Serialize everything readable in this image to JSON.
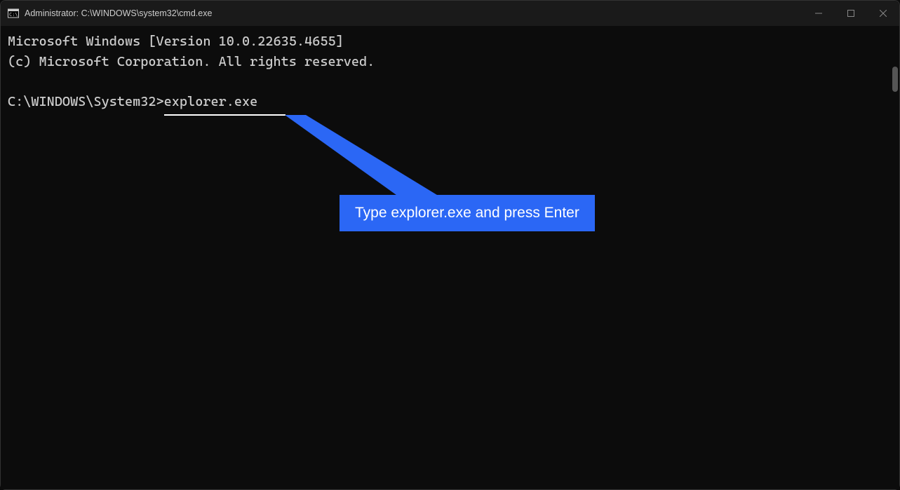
{
  "window": {
    "title": "Administrator: C:\\WINDOWS\\system32\\cmd.exe"
  },
  "terminal": {
    "line1": "Microsoft Windows [Version 10.0.22635.4655]",
    "line2": "(c) Microsoft Corporation. All rights reserved.",
    "prompt": "C:\\WINDOWS\\System32>",
    "command": "explorer.exe"
  },
  "callout": {
    "text": "Type explorer.exe and press Enter"
  }
}
